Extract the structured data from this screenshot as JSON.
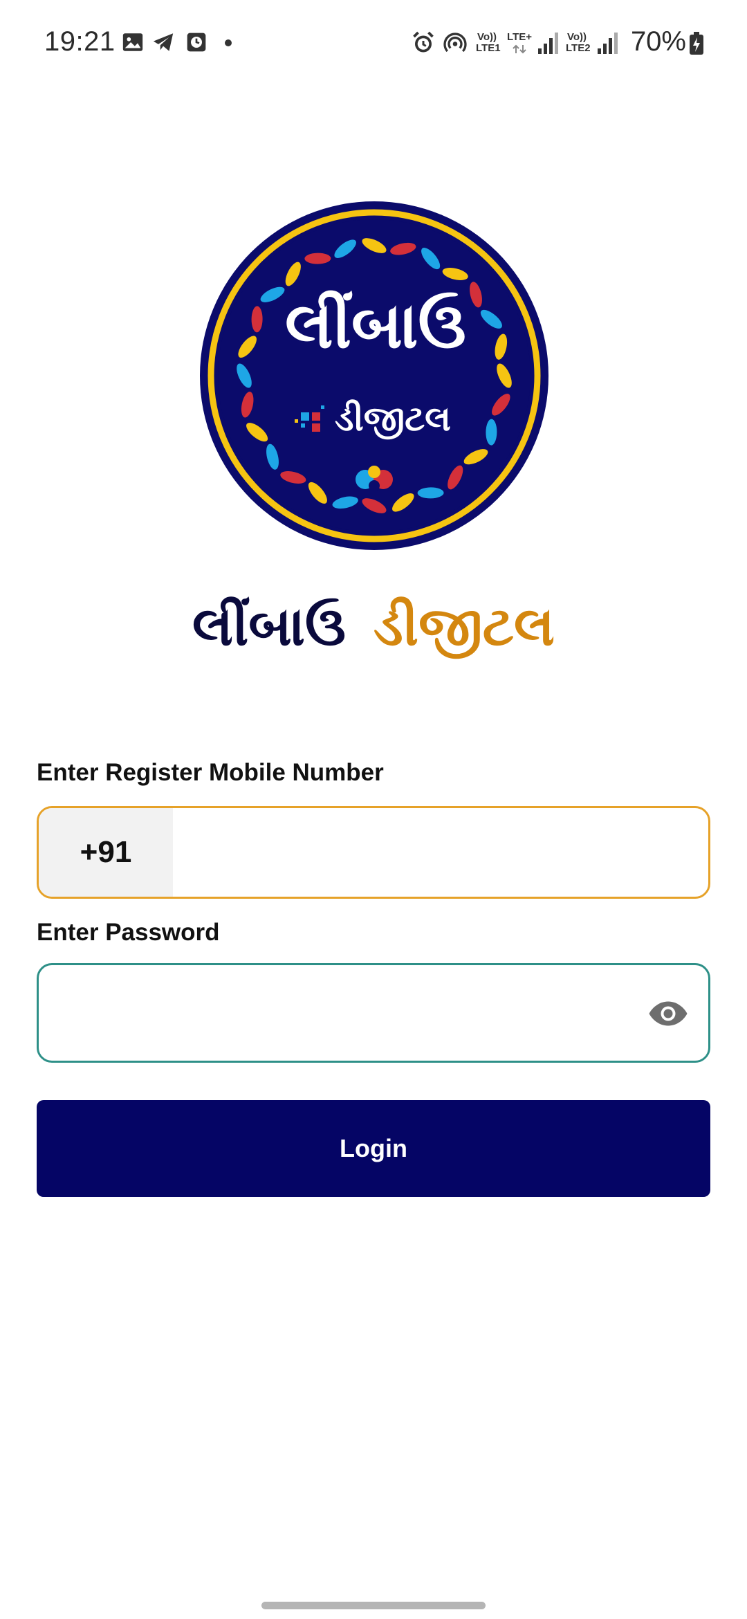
{
  "status_bar": {
    "time": "19:21",
    "battery": "70%",
    "net1_top": "Vo))",
    "net1_bottom": "LTE1",
    "net_lte_plus": "LTE+",
    "net2_top": "Vo))",
    "net2_bottom": "LTE2",
    "notification_icons": [
      "image-icon",
      "telegram-icon",
      "clock-app-icon",
      "more-dot-icon"
    ],
    "system_icons": [
      "alarm-icon",
      "hotspot-icon",
      "signal-icon",
      "battery-icon"
    ]
  },
  "logo": {
    "line1": "લીંબાઉ",
    "line2": "ડીજીટલ",
    "colors": {
      "navy": "#0b0b6b",
      "gold": "#f6c412",
      "red": "#d4303a",
      "blue": "#1ea6e6"
    }
  },
  "brand": {
    "title_part1": "લીંબાઉ",
    "title_part2": "ડીજીટલ",
    "color_part1": "#0a0a3c",
    "color_part2": "#d4870f"
  },
  "form": {
    "mobile_label": "Enter Register Mobile Number",
    "country_code": "+91",
    "mobile_value": "",
    "password_label": "Enter Password",
    "password_value": "",
    "login_label": "Login",
    "accent_mobile": "#e6a229",
    "accent_password": "#2e9088",
    "button_color": "#050565"
  }
}
